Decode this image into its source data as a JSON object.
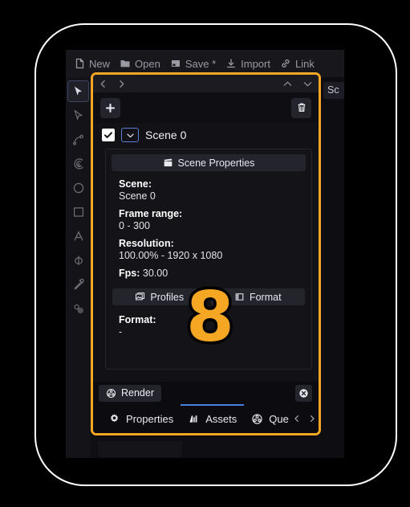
{
  "toolbar": {
    "items": [
      {
        "label": "New",
        "icon": "new-file-icon"
      },
      {
        "label": "Open",
        "icon": "folder-open-icon"
      },
      {
        "label": "Save *",
        "icon": "save-disk-icon"
      },
      {
        "label": "Import",
        "icon": "import-download-icon"
      },
      {
        "label": "Link",
        "icon": "link-chain-icon"
      }
    ]
  },
  "tool_rail": {
    "tools": [
      {
        "name": "select-arrow-tool",
        "active": true
      },
      {
        "name": "direct-select-tool",
        "active": false
      },
      {
        "name": "pen-path-tool",
        "active": false
      },
      {
        "name": "spiral-tool",
        "active": false
      },
      {
        "name": "ellipse-tool",
        "active": false
      },
      {
        "name": "rectangle-tool",
        "active": false
      },
      {
        "name": "text-tool",
        "active": false
      },
      {
        "name": "no-fill-tool",
        "active": false
      },
      {
        "name": "eyedropper-tool",
        "active": false
      },
      {
        "name": "nodes-tool",
        "active": false
      }
    ]
  },
  "right_panel": {
    "tab_label": "Sc"
  },
  "scene_panel": {
    "nav": {
      "back_icon": "chevron-left-icon",
      "forward_icon": "chevron-right-icon",
      "collapse_icon": "chevron-up-icon",
      "expand_icon": "chevron-down-icon"
    },
    "actions": {
      "add_label": "+",
      "delete_icon": "trash-icon"
    },
    "scene_row": {
      "checked": true,
      "name": "Scene 0"
    },
    "scene_properties_button": {
      "label": "Scene Properties",
      "icon": "clapperboard-icon"
    },
    "properties": {
      "scene_key": "Scene:",
      "scene_value": "Scene 0",
      "frame_range_key": "Frame range:",
      "frame_range_value": "0 - 300",
      "resolution_key": "Resolution:",
      "resolution_value": "100.00% - 1920 x 1080",
      "fps_key": "Fps:",
      "fps_value": "30.00"
    },
    "profiles_button": {
      "label": "Profiles",
      "icon": "profiles-image-icon"
    },
    "format_button": {
      "label": "Format",
      "icon": "film-strip-icon"
    },
    "format_block": {
      "key": "Format:",
      "value": "-"
    },
    "render_button": {
      "label": "Render",
      "icon": "film-reel-icon"
    },
    "close_button": {
      "icon": "close-circle-icon"
    },
    "tabs": [
      {
        "label": "Properties",
        "icon": "gear-icon",
        "active": false
      },
      {
        "label": "Assets",
        "icon": "bar-chart-icon",
        "active": true
      },
      {
        "label": "Que",
        "icon": "film-reel-icon",
        "active": false
      }
    ],
    "tab_overflow": {
      "prev_icon": "chevron-left-icon",
      "next_icon": "chevron-right-icon"
    }
  },
  "step_badge": {
    "number": "8"
  },
  "colors": {
    "highlight": "#f5a623",
    "accent_blue": "#4b7fe0",
    "panel_bg": "#111116",
    "app_bg": "#0c0c0f",
    "frame_outline": "#ffffff"
  }
}
